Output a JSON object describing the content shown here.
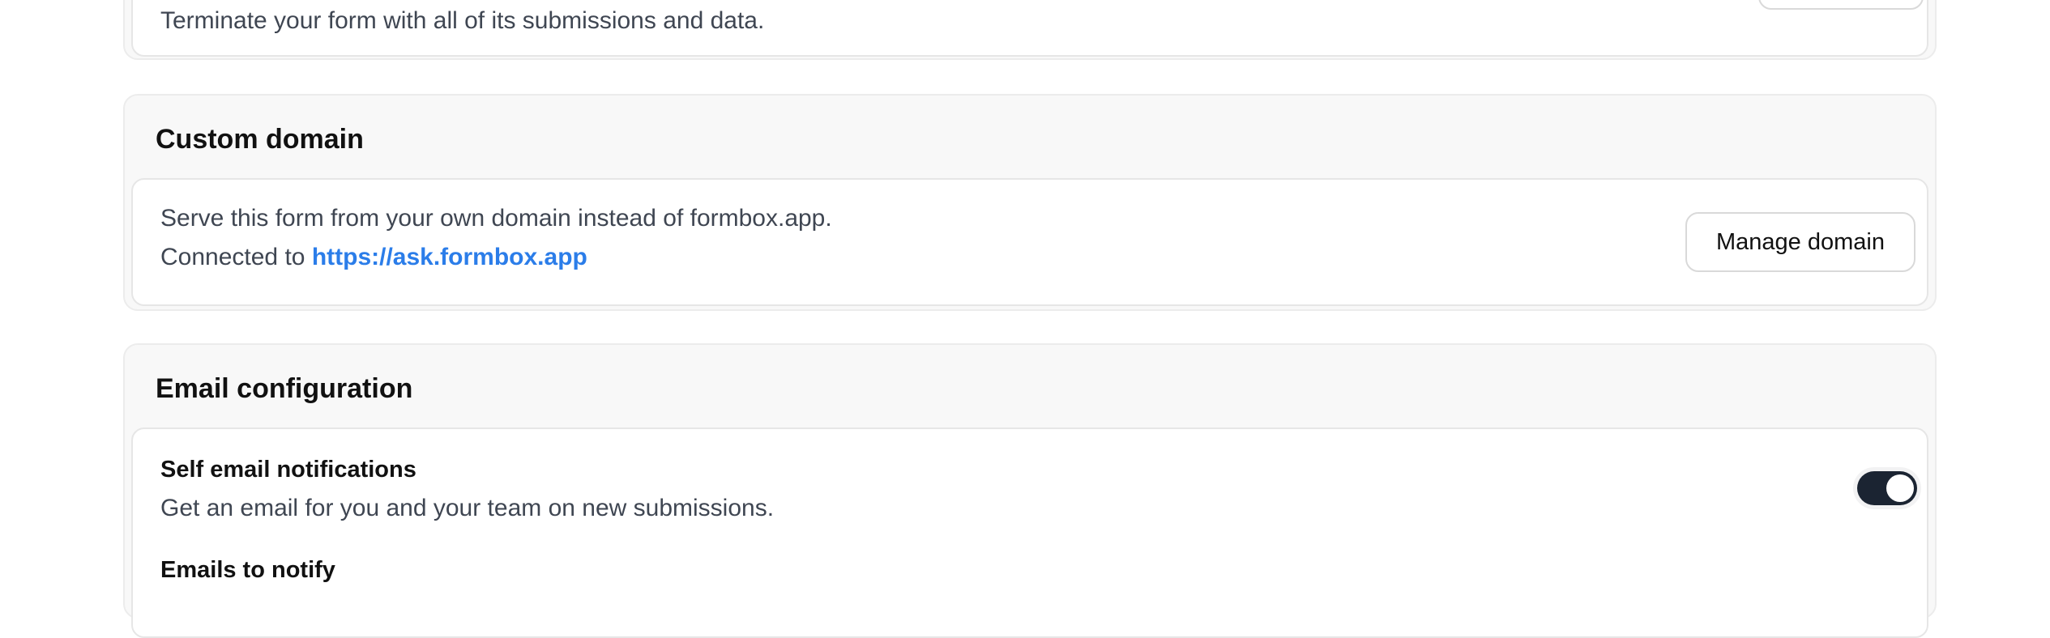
{
  "delete_section": {
    "description": "Terminate your form with all of its submissions and data."
  },
  "custom_domain": {
    "title": "Custom domain",
    "description": "Serve this form from your own domain instead of formbox.app.",
    "connected_prefix": "Connected to",
    "connected_url": "https://ask.formbox.app",
    "button_label": "Manage domain"
  },
  "email_configuration": {
    "title": "Email configuration",
    "self_notifications": {
      "label": "Self email notifications",
      "description": "Get an email for you and your team on new submissions.",
      "enabled": true
    },
    "emails_to_notify_label": "Emails to notify"
  },
  "colors": {
    "link": "#2b7de9",
    "toggle_on": "#1b2432",
    "danger": "#e0342f"
  }
}
